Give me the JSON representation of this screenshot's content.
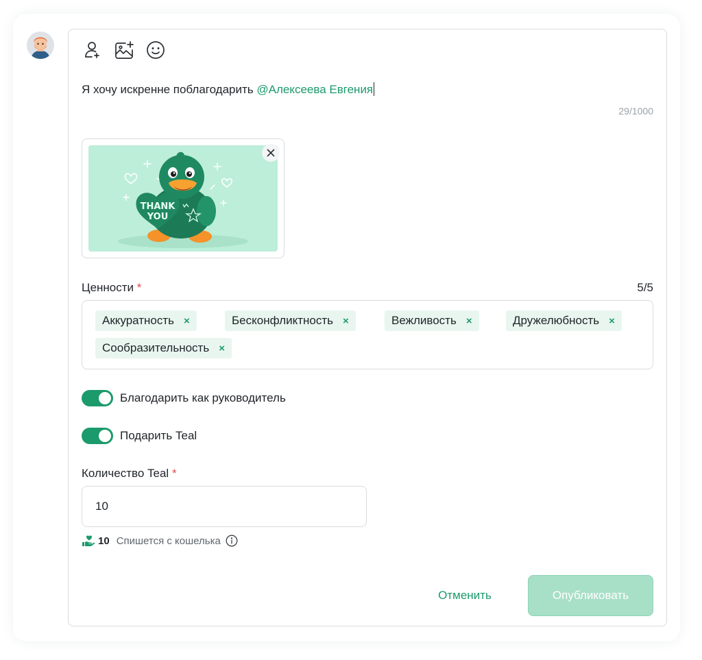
{
  "toolbar": {
    "icons": [
      "mention-user-icon",
      "add-image-icon",
      "emoji-icon"
    ]
  },
  "message": {
    "text": "Я хочу искренне поблагодарить ",
    "mention": "@Алексеева Евгения",
    "counter": "29/1000"
  },
  "attachment": {
    "image_text_line1": "THANK",
    "image_text_line2": "YOU"
  },
  "values": {
    "label": "Ценности",
    "required_mark": "*",
    "count": "5/5",
    "chips": [
      {
        "label": "Аккуратность"
      },
      {
        "label": "Бесконфликтность"
      },
      {
        "label": "Вежливость"
      },
      {
        "label": "Дружелюбность"
      },
      {
        "label": "Сообразительность"
      }
    ],
    "chip_remove_glyph": "×"
  },
  "toggles": {
    "as_manager": {
      "label": "Благодарить как руководитель",
      "on": true
    },
    "gift_teal": {
      "label": "Подарить Teal",
      "on": true
    }
  },
  "amount": {
    "label": "Количество Teal",
    "required_mark": "*",
    "value": "10",
    "wallet_amount": "10",
    "wallet_note": "Спишется с кошелька"
  },
  "actions": {
    "cancel_label": "Отменить",
    "publish_label": "Опубликовать"
  },
  "colors": {
    "accent": "#1b9a6c",
    "chip_bg": "#e9f6f0",
    "publish_disabled": "#a8dfc7",
    "required": "#e5484d"
  }
}
